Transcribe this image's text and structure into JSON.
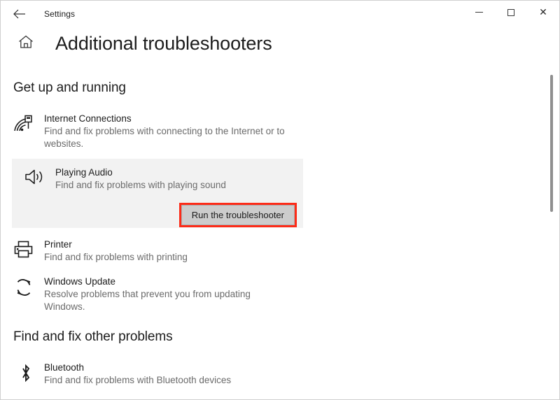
{
  "window": {
    "titlebar_label": "Settings",
    "back_icon": "back-arrow-icon",
    "minimize_label": "—",
    "maximize_label": "",
    "close_label": "✕"
  },
  "header": {
    "home_icon": "home-icon",
    "page_title": "Additional troubleshooters"
  },
  "sections": [
    {
      "heading": "Get up and running",
      "items": [
        {
          "icon": "internet-connections-icon",
          "name": "Internet Connections",
          "description": "Find and fix problems with connecting to the Internet or to websites.",
          "selected": false
        },
        {
          "icon": "playing-audio-icon",
          "name": "Playing Audio",
          "description": "Find and fix problems with playing sound",
          "selected": true,
          "action_label": "Run the troubleshooter"
        },
        {
          "icon": "printer-icon",
          "name": "Printer",
          "description": "Find and fix problems with printing",
          "selected": false
        },
        {
          "icon": "windows-update-icon",
          "name": "Windows Update",
          "description": "Resolve problems that prevent you from updating Windows.",
          "selected": false
        }
      ]
    },
    {
      "heading": "Find and fix other problems",
      "items": [
        {
          "icon": "bluetooth-icon",
          "name": "Bluetooth",
          "description": "Find and fix problems with Bluetooth devices",
          "selected": false
        }
      ]
    }
  ],
  "colors": {
    "annotation_red": "#fc2b18",
    "selected_row_bg": "#f2f2f2",
    "button_bg": "#cccccc",
    "text_primary": "#1b1b1b",
    "text_secondary": "#6b6b6b"
  }
}
